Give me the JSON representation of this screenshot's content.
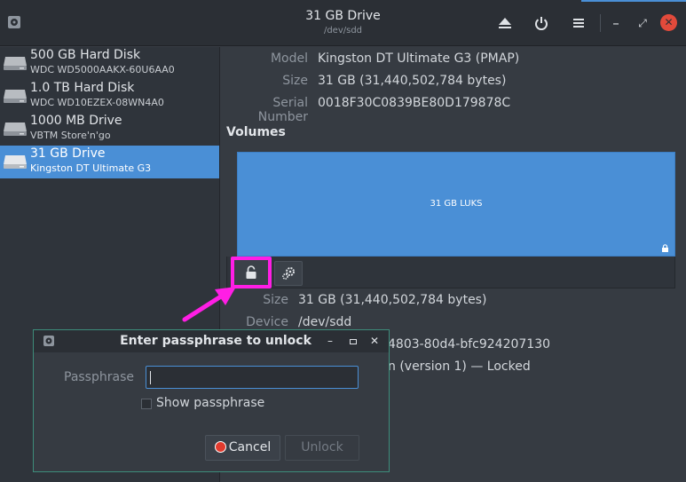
{
  "window": {
    "title": "31 GB Drive",
    "subtitle": "/dev/sdd",
    "icons": [
      "disks-app-icon",
      "eject-icon",
      "power-icon",
      "menu-icon",
      "minimize-icon",
      "restore-icon",
      "close-icon"
    ],
    "controls": {
      "minimize": "–",
      "restore": "⤢",
      "close": "✕"
    },
    "accent_color": "#4a8fd6",
    "close_color": "#e24a3b"
  },
  "sidebar": {
    "items": [
      {
        "name": "500 GB Hard Disk",
        "description": "WDC WD5000AAKX-60U6AA0"
      },
      {
        "name": "1.0 TB Hard Disk",
        "description": "WDC WD10EZEX-08WN4A0"
      },
      {
        "name": "1000 MB Drive",
        "description": "VBTM Store'n'go"
      },
      {
        "name": "31 GB Drive",
        "description": "Kingston DT Ultimate G3"
      }
    ],
    "selected_index": 3
  },
  "drive_info": {
    "model_label": "Model",
    "model_value": "Kingston DT Ultimate G3 (PMAP)",
    "size_label": "Size",
    "size_value": "31 GB (31,440,502,784 bytes)",
    "serial_label": "Serial Number",
    "serial_value": "0018F30C0839BE80D179878C"
  },
  "volumes": {
    "title": "Volumes",
    "partition_label": "31 GB LUKS",
    "toolbar": {
      "unlock_icon": "unlock-icon",
      "settings_icon": "gears-icon"
    }
  },
  "volume_info": {
    "size_label": "Size",
    "size_value": "31 GB (31,440,502,784 bytes)",
    "device_label": "Device",
    "device_value": "/dev/sdd",
    "uuid_partial": "4803-80d4-bfc924207130",
    "contents_partial": "n (version 1) — Locked"
  },
  "dialog": {
    "title": "Enter passphrase to unlock",
    "passphrase_label": "Passphrase",
    "passphrase_value": "",
    "show_passphrase_label": "Show passphrase",
    "show_passphrase_checked": false,
    "cancel_label": "Cancel",
    "unlock_label": "Unlock",
    "unlock_enabled": false,
    "border_color": "#3d8c7a"
  },
  "annotation": {
    "highlight_color": "#ff1ee5"
  }
}
